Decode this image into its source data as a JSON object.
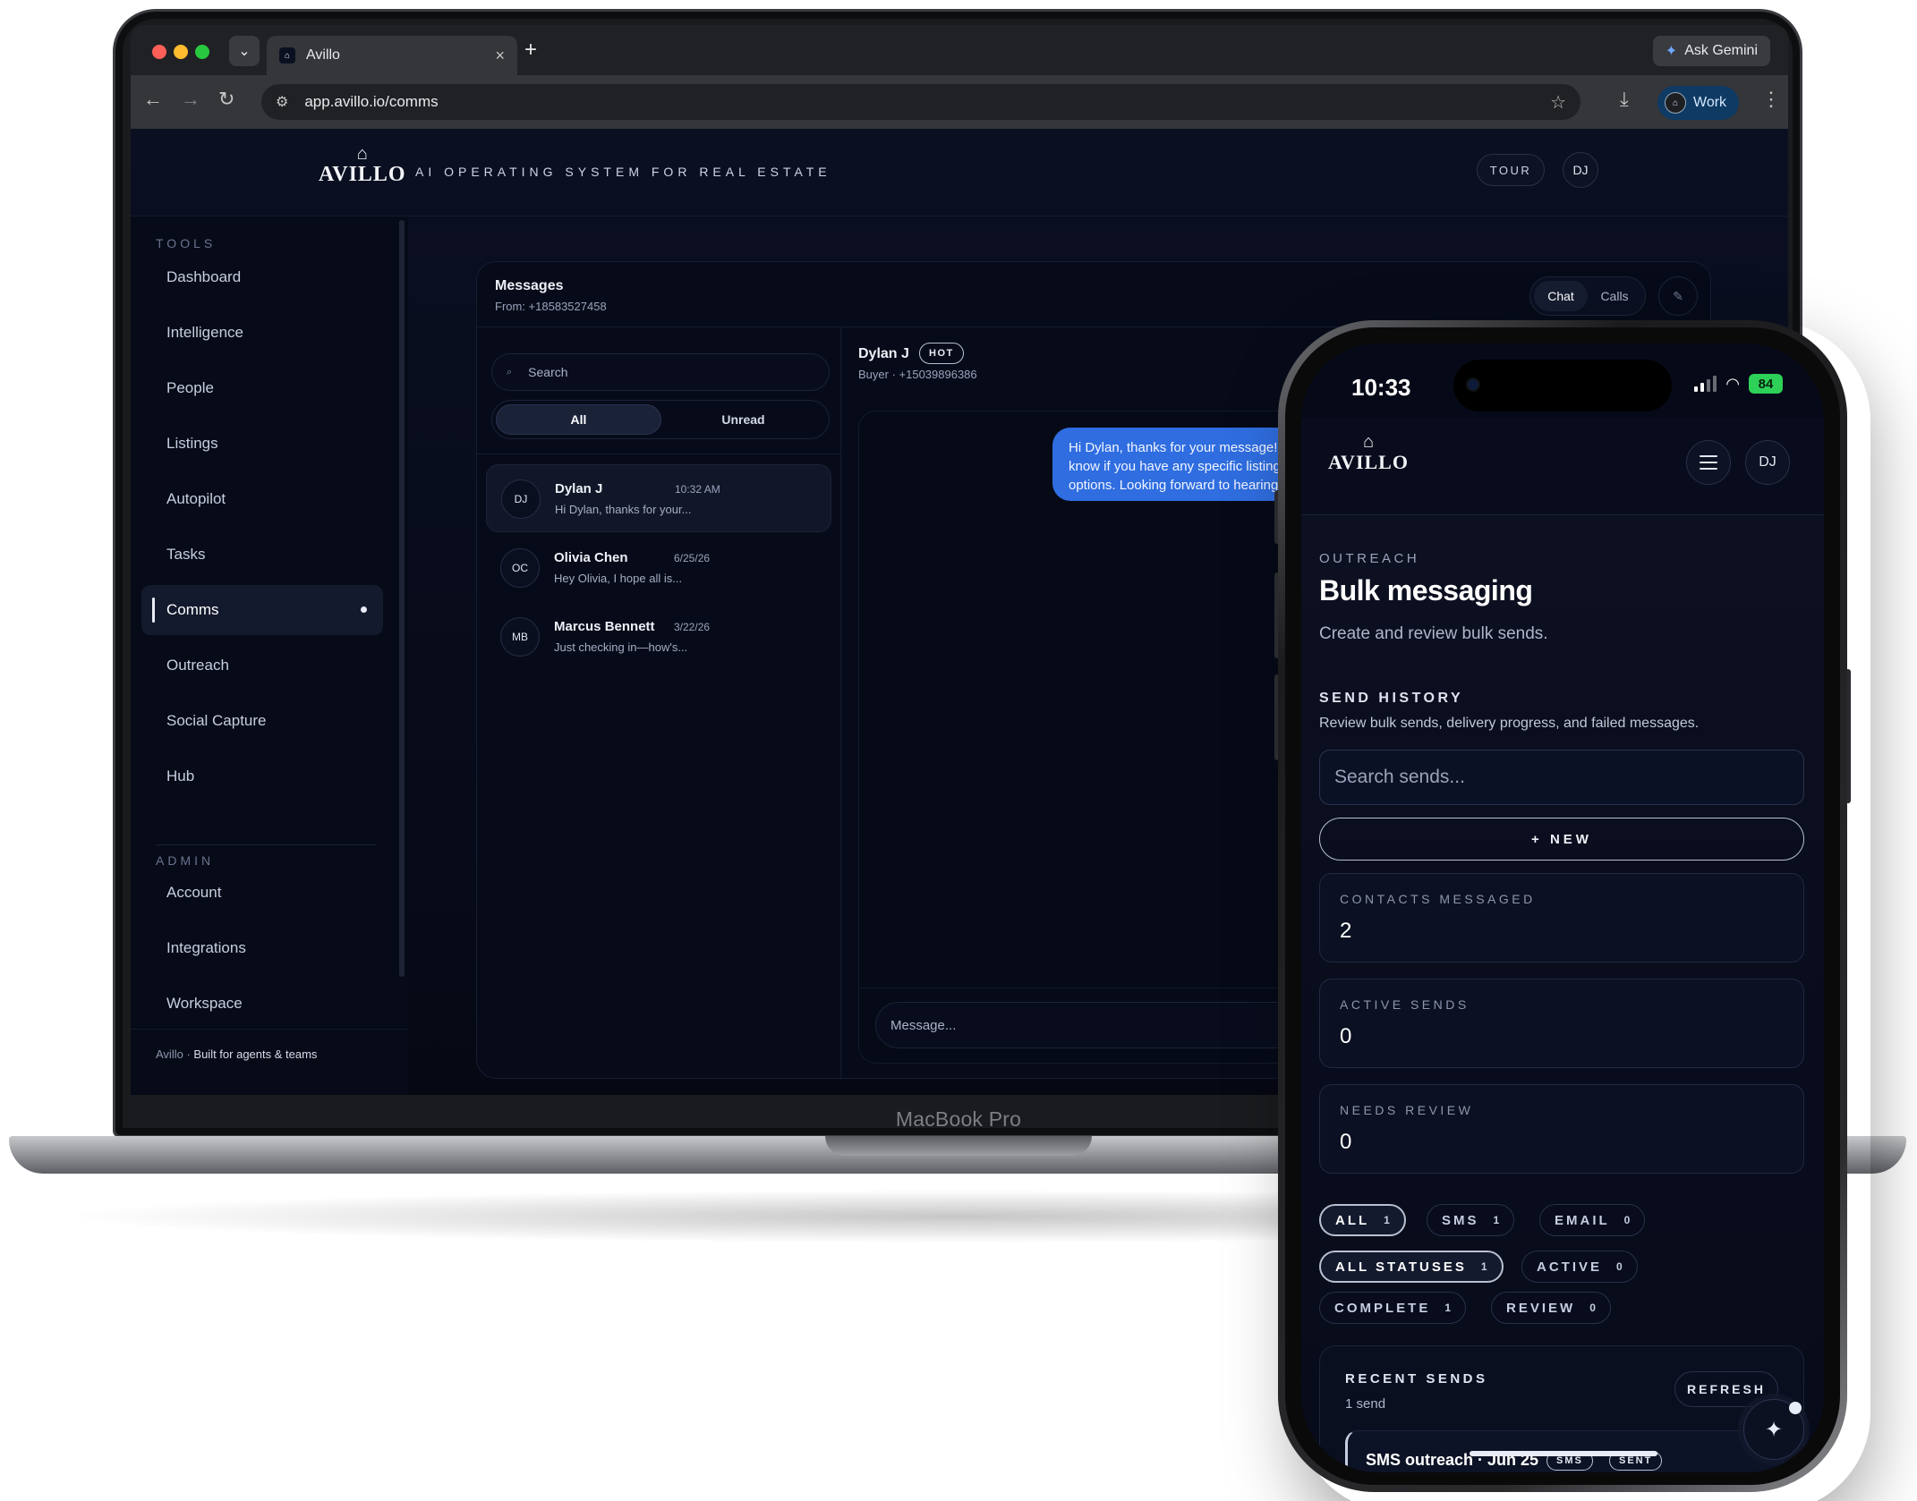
{
  "browser": {
    "tab_title": "Avillo",
    "ask_gemini": "Ask Gemini",
    "url": "app.avillo.io/comms",
    "profile": "Work"
  },
  "app": {
    "logo": "AVILLO",
    "tagline": "AI OPERATING SYSTEM FOR REAL ESTATE",
    "tour": "TOUR",
    "user_initials": "DJ"
  },
  "sidebar": {
    "tools_heading": "TOOLS",
    "tools": [
      {
        "label": "Dashboard"
      },
      {
        "label": "Intelligence"
      },
      {
        "label": "People"
      },
      {
        "label": "Listings"
      },
      {
        "label": "Autopilot"
      },
      {
        "label": "Tasks"
      },
      {
        "label": "Comms",
        "active": true
      },
      {
        "label": "Outreach"
      },
      {
        "label": "Social Capture"
      },
      {
        "label": "Hub"
      }
    ],
    "admin_heading": "ADMIN",
    "admin": [
      {
        "label": "Account"
      },
      {
        "label": "Integrations"
      },
      {
        "label": "Workspace"
      }
    ],
    "footer_brand": "Avillo",
    "footer_text": "Built for agents & teams"
  },
  "messages": {
    "title": "Messages",
    "from": "From: +18583527458",
    "tabs": {
      "chat": "Chat",
      "calls": "Calls"
    },
    "search_placeholder": "Search",
    "filters": {
      "all": "All",
      "unread": "Unread"
    },
    "conversations": [
      {
        "initials": "DJ",
        "name": "Dylan J",
        "time": "10:32 AM",
        "preview": "Hi Dylan, thanks for your..."
      },
      {
        "initials": "OC",
        "name": "Olivia Chen",
        "time": "6/25/26",
        "preview": "Hey Olivia, I hope all is..."
      },
      {
        "initials": "MB",
        "name": "Marcus Bennett",
        "time": "3/22/26",
        "preview": "Just checking in—how's..."
      }
    ],
    "active_chat": {
      "name": "Dylan J",
      "badge": "HOT",
      "meta": "Buyer · +15039896386",
      "bubble": "Hi Dylan, thanks for your message! Let me know if you have any specific listing options. Looking forward to hearing from you.",
      "input_placeholder": "Message..."
    }
  },
  "laptop_label": "MacBook Pro",
  "phone": {
    "time": "10:33",
    "battery": "84",
    "logo": "AVILLO",
    "user_initials": "DJ",
    "eyebrow": "OUTREACH",
    "title": "Bulk messaging",
    "subtitle": "Create and review bulk sends.",
    "history_title": "SEND HISTORY",
    "history_sub": "Review bulk sends, delivery progress, and failed messages.",
    "search_placeholder": "Search sends...",
    "new_button": "+ NEW",
    "stats": [
      {
        "label": "CONTACTS MESSAGED",
        "value": "2"
      },
      {
        "label": "ACTIVE SENDS",
        "value": "0"
      },
      {
        "label": "NEEDS REVIEW",
        "value": "0"
      }
    ],
    "channel_filters": [
      {
        "label": "ALL",
        "count": "1",
        "selected": true
      },
      {
        "label": "SMS",
        "count": "1"
      },
      {
        "label": "EMAIL",
        "count": "0"
      }
    ],
    "status_filters": [
      {
        "label": "ALL STATUSES",
        "count": "1",
        "selected": true
      },
      {
        "label": "ACTIVE",
        "count": "0"
      },
      {
        "label": "COMPLETE",
        "count": "1"
      },
      {
        "label": "REVIEW",
        "count": "0"
      }
    ],
    "recent": {
      "title": "RECENT SENDS",
      "count": "1 send",
      "refresh": "REFRESH",
      "item_title": "SMS outreach · Jun 25",
      "item_tags": [
        "SMS",
        "SENT"
      ]
    }
  }
}
